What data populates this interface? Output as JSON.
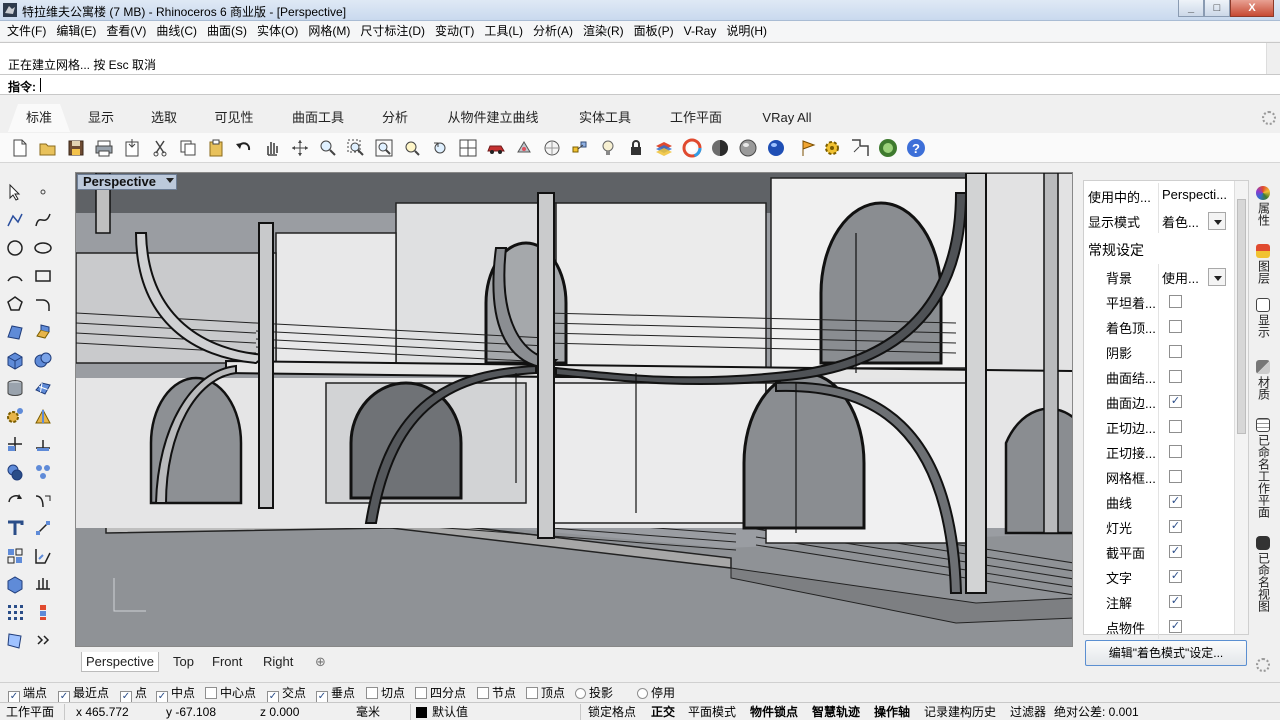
{
  "window": {
    "title": "特拉维夫公寓楼 (7 MB) - Rhinoceros 6 商业版 - [Perspective]",
    "minimize": "_",
    "maximize": "□",
    "close": "X"
  },
  "menu": [
    "文件(F)",
    "编辑(E)",
    "查看(V)",
    "曲线(C)",
    "曲面(S)",
    "实体(O)",
    "网格(M)",
    "尺寸标注(D)",
    "变动(T)",
    "工具(L)",
    "分析(A)",
    "渲染(R)",
    "面板(P)",
    "V-Ray",
    "说明(H)"
  ],
  "command": {
    "history": "正在建立网格... 按 Esc 取消",
    "prompt_label": "指令:"
  },
  "tabs": [
    "标准",
    "显示",
    "选取",
    "可见性",
    "曲面工具",
    "分析",
    "从物件建立曲线",
    "实体工具",
    "工作平面",
    "VRay All"
  ],
  "viewport": {
    "name": "Perspective"
  },
  "viewport_tabs": [
    "Perspective",
    "Top",
    "Front",
    "Right",
    "⊕"
  ],
  "panel": {
    "rows": [
      {
        "key": "使用中的...",
        "value": "Perspecti..."
      },
      {
        "key": "显示模式",
        "value": "着色..."
      }
    ],
    "section": "常规设定",
    "background": {
      "key": "背景",
      "value": "使用..."
    },
    "options": [
      {
        "label": "平坦着...",
        "checked": false
      },
      {
        "label": "着色顶...",
        "checked": false
      },
      {
        "label": "阴影",
        "checked": false
      },
      {
        "label": "曲面结...",
        "checked": false
      },
      {
        "label": "曲面边...",
        "checked": true
      },
      {
        "label": "正切边...",
        "checked": false
      },
      {
        "label": "正切接...",
        "checked": false
      },
      {
        "label": "网格框...",
        "checked": false
      },
      {
        "label": "曲线",
        "checked": true
      },
      {
        "label": "灯光",
        "checked": true
      },
      {
        "label": "截平面",
        "checked": true
      },
      {
        "label": "文字",
        "checked": true
      },
      {
        "label": "注解",
        "checked": true
      },
      {
        "label": "点物件",
        "checked": true
      }
    ],
    "button": "编辑\"着色模式\"设定..."
  },
  "side_tabs": [
    "属性",
    "图层",
    "显示",
    "材质",
    "已命名工作平面",
    "已命名视图"
  ],
  "osnaps": [
    {
      "label": "端点",
      "checked": true
    },
    {
      "label": "最近点",
      "checked": true
    },
    {
      "label": "点",
      "checked": true
    },
    {
      "label": "中点",
      "checked": true
    },
    {
      "label": "中心点",
      "checked": false
    },
    {
      "label": "交点",
      "checked": true
    },
    {
      "label": "垂点",
      "checked": true
    },
    {
      "label": "切点",
      "checked": false
    },
    {
      "label": "四分点",
      "checked": false
    },
    {
      "label": "节点",
      "checked": false
    },
    {
      "label": "顶点",
      "checked": false
    },
    {
      "label": "投影",
      "checked": false,
      "radio": true
    },
    {
      "label": "停用",
      "checked": false,
      "radio": true
    }
  ],
  "status": {
    "cplane": "工作平面",
    "x": "x 465.772",
    "y": "y -67.108",
    "z": "z 0.000",
    "units": "毫米",
    "layer": "默认值",
    "grid_snap": "锁定格点",
    "ortho": "正交",
    "planar": "平面模式",
    "osnap": "物件锁点",
    "smarttrack": "智慧轨迹",
    "gumball": "操作轴",
    "history": "记录建构历史",
    "filter": "过滤器",
    "tolerance": "绝对公差: 0.001"
  },
  "colors": {
    "title_bar": "#c9d9ee",
    "viewport_bg": "#8f9296",
    "viewport_label": "#bcc9db",
    "accent": "#5b8fd1"
  }
}
